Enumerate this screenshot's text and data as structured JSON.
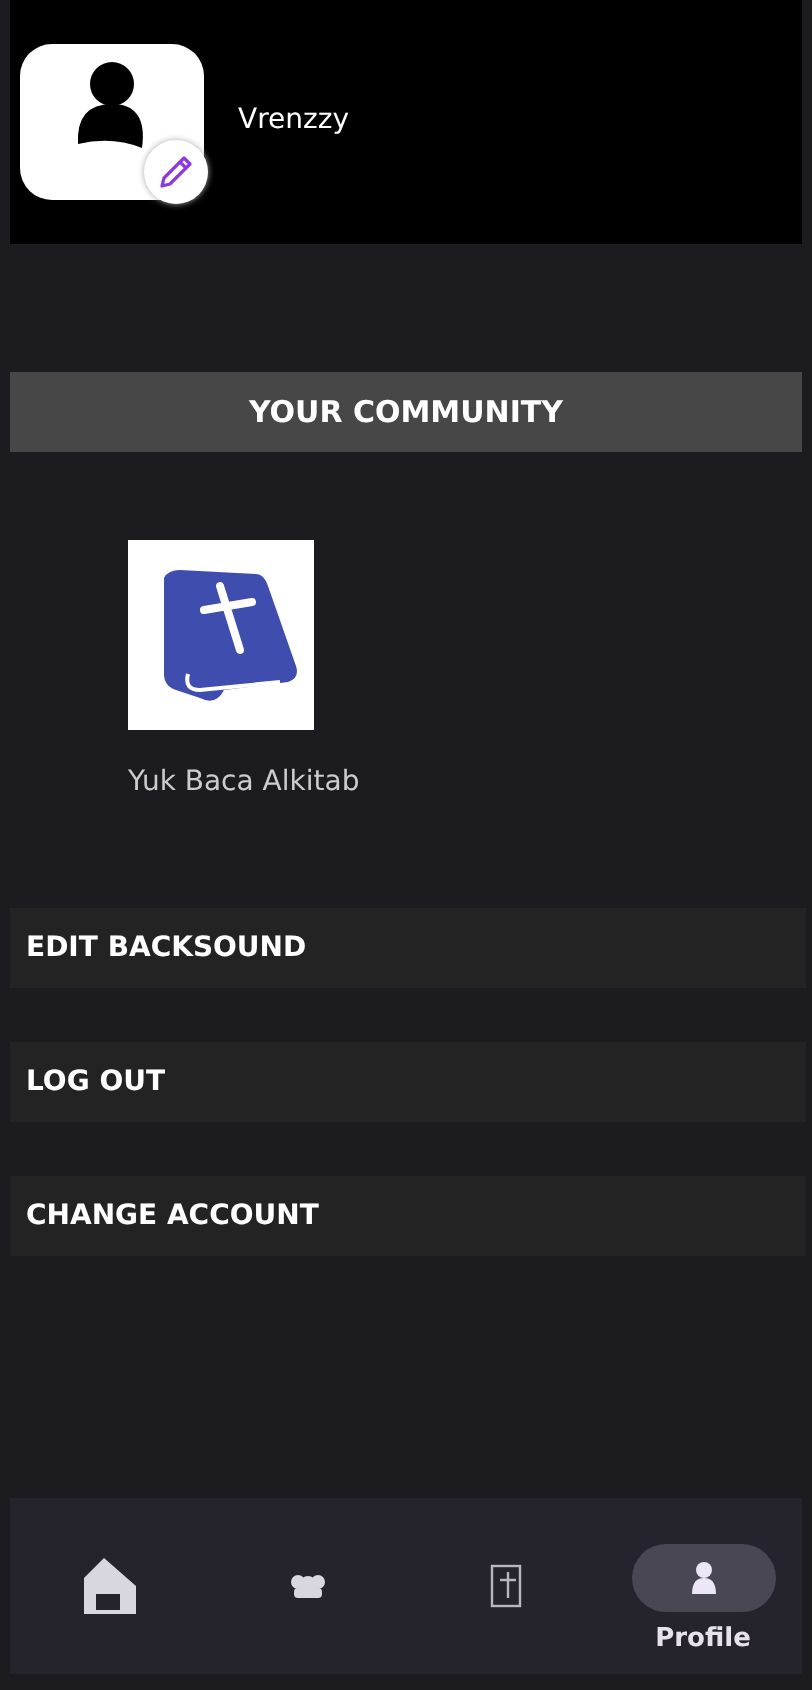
{
  "profile": {
    "username": "Vrenzzy"
  },
  "community": {
    "heading": "YOUR COMMUNITY",
    "items": [
      {
        "name": "Yuk Baca Alkitab"
      }
    ]
  },
  "menu": [
    "EDIT BACKSOUND",
    "LOG OUT",
    "CHANGE ACCOUNT"
  ],
  "nav": [
    {
      "kind": "home",
      "selected": false
    },
    {
      "kind": "group",
      "selected": false
    },
    {
      "kind": "bible",
      "selected": false
    },
    {
      "kind": "profile",
      "selected": true,
      "label": "Profile"
    }
  ]
}
